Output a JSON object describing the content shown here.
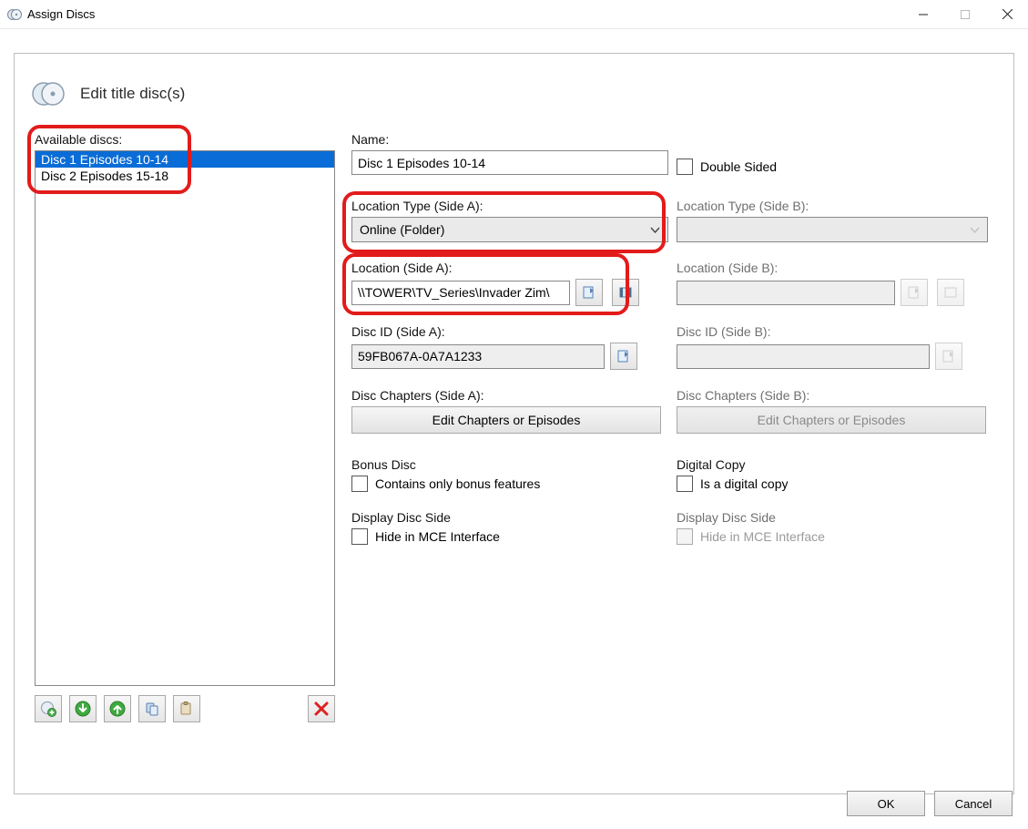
{
  "window": {
    "title": "Assign Discs"
  },
  "header": {
    "title": "Edit title disc(s)"
  },
  "sidebar": {
    "label": "Available discs:",
    "items": [
      {
        "label": "Disc 1 Episodes 10-14",
        "selected": true
      },
      {
        "label": "Disc 2 Episodes 15-18",
        "selected": false
      }
    ]
  },
  "form": {
    "name_label": "Name:",
    "name_value": "Disc 1 Episodes 10-14",
    "double_sided_label": "Double Sided",
    "loc_type_a_label": "Location Type (Side A):",
    "loc_type_a_value": "Online (Folder)",
    "loc_type_b_label": "Location Type (Side B):",
    "loc_a_label": "Location (Side A):",
    "loc_a_value": "\\\\TOWER\\TV_Series\\Invader Zim\\",
    "loc_b_label": "Location (Side B):",
    "disc_id_a_label": "Disc ID (Side A):",
    "disc_id_a_value": "59FB067A-0A7A1233",
    "disc_id_b_label": "Disc ID (Side B):",
    "chapters_a_label": "Disc Chapters (Side A):",
    "chapters_b_label": "Disc Chapters (Side B):",
    "edit_chapters_label": "Edit Chapters or Episodes",
    "bonus_label": "Bonus Disc",
    "bonus_chk": "Contains only bonus features",
    "digital_label": "Digital Copy",
    "digital_chk": "Is a digital copy",
    "display_side_label": "Display Disc Side",
    "hide_mce_label": "Hide in MCE Interface"
  },
  "footer": {
    "ok": "OK",
    "cancel": "Cancel"
  }
}
